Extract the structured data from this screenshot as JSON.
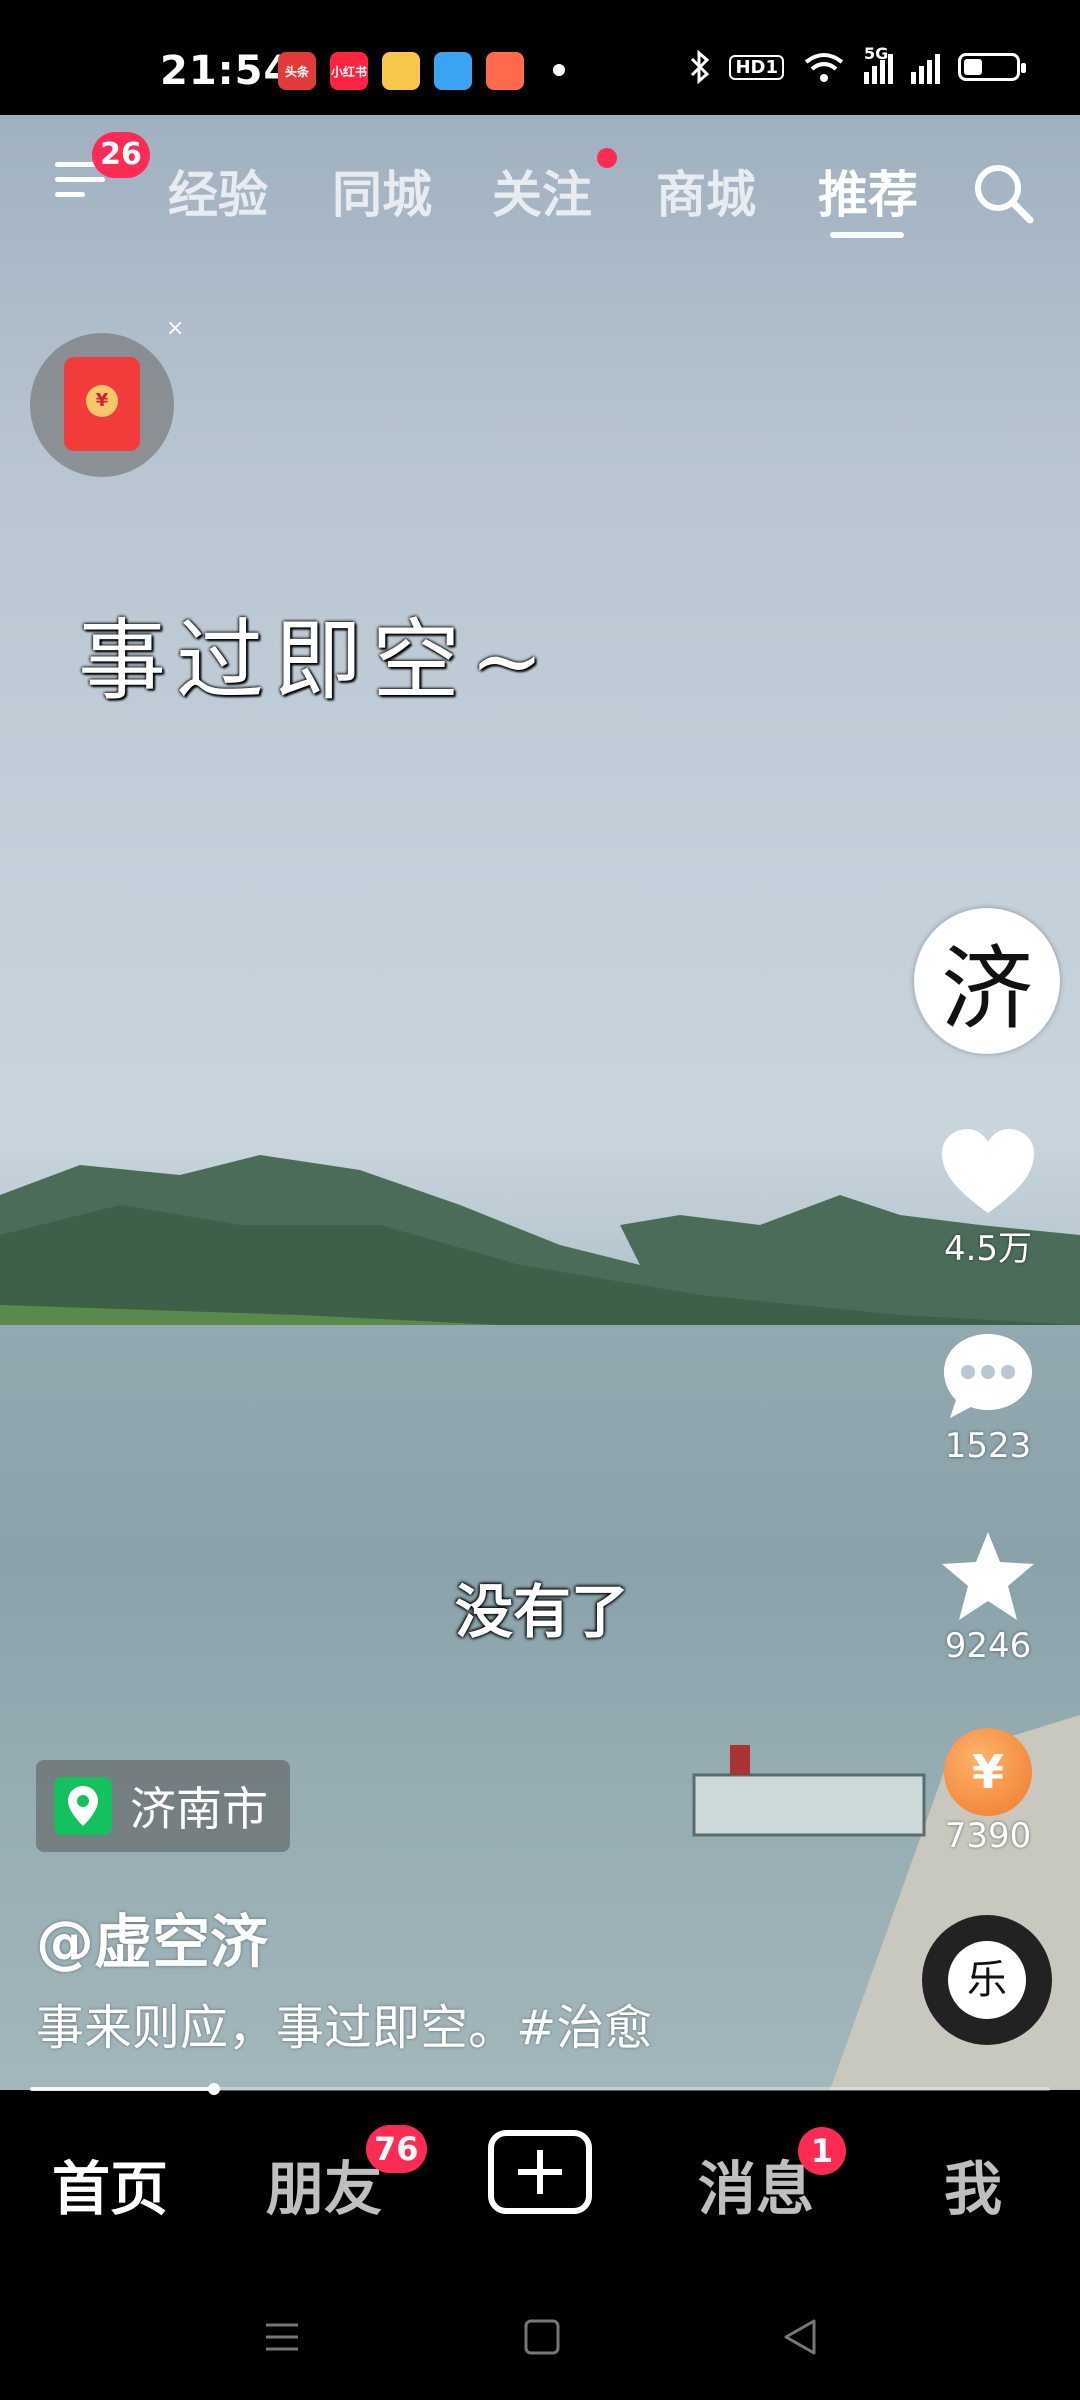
{
  "status_bar": {
    "time": "21:54",
    "notification_apps": [
      {
        "icon": "toutiao-icon",
        "label": "头条",
        "color": "#e33b3b"
      },
      {
        "icon": "xiaohongshu-icon",
        "label": "小红书",
        "color": "#ff2442"
      },
      {
        "icon": "weibo-icon",
        "label": "",
        "color": "#f6c74b"
      },
      {
        "icon": "browser-icon",
        "label": "",
        "color": "#3aa3f2"
      },
      {
        "icon": "music-icon",
        "label": "",
        "color": "#ff6a4d"
      }
    ],
    "hd_label": "HD1",
    "network_label": "5G"
  },
  "top_nav": {
    "menu_badge": "26",
    "tabs": [
      "经验",
      "同城",
      "关注",
      "商城",
      "推荐"
    ],
    "active_tab": "推荐"
  },
  "video": {
    "overlay_text": "事过即空~",
    "subtitle": "没有了",
    "author_avatar_glyph": "济",
    "music_disc_glyph": "乐"
  },
  "actions": {
    "likes": "4.5万",
    "comments": "1523",
    "favorites": "9246",
    "shares": "7390",
    "coin_symbol": "¥"
  },
  "post": {
    "location": "济南市",
    "author": "@虚空济",
    "caption": "事来则应，事过即空。#治愈"
  },
  "progress": {
    "fraction": 0.18
  },
  "bottom_nav": {
    "home": "首页",
    "friends": "朋友",
    "friends_badge": "76",
    "messages": "消息",
    "messages_badge": "1",
    "me": "我"
  }
}
